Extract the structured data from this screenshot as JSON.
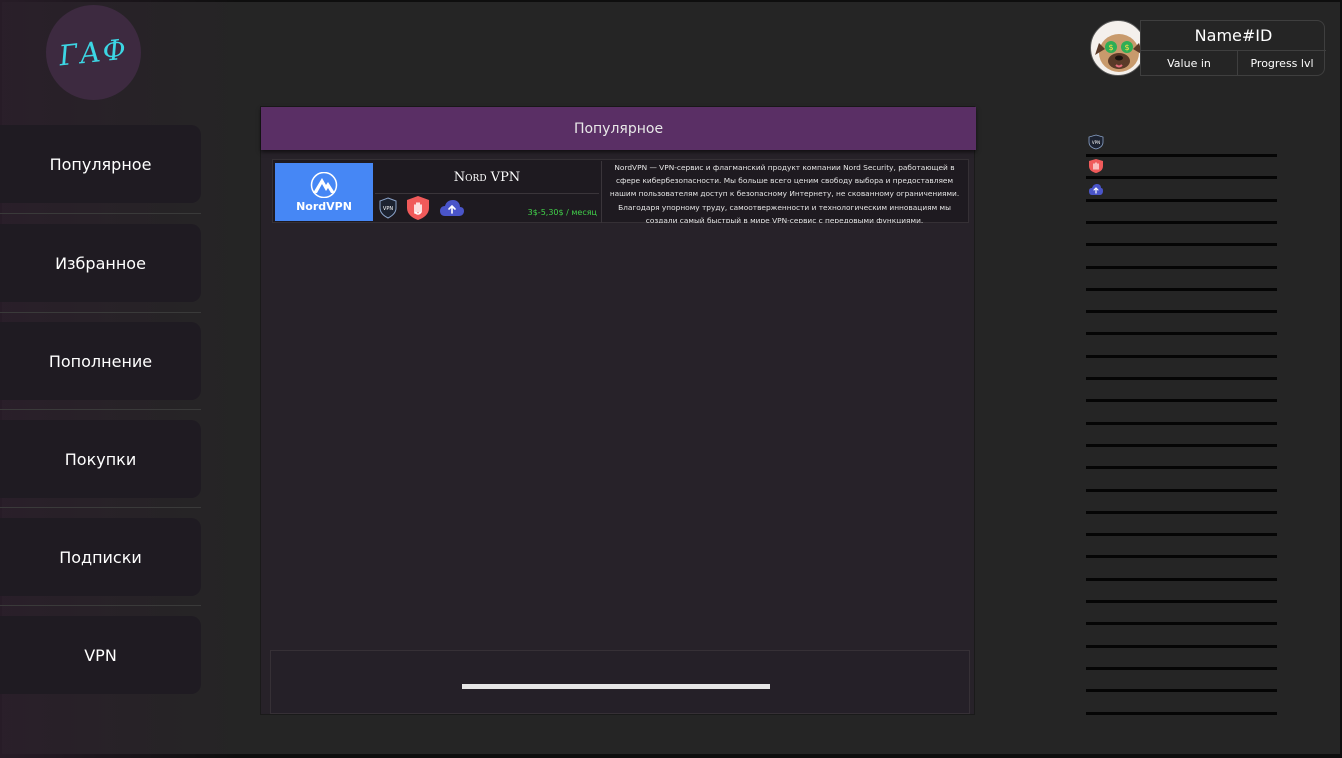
{
  "logo": {
    "text": "ГАФ"
  },
  "nav": {
    "items": [
      {
        "id": "popular",
        "label": "Популярное"
      },
      {
        "id": "favorites",
        "label": "Избранное"
      },
      {
        "id": "topup",
        "label": "Пополнение"
      },
      {
        "id": "purchases",
        "label": "Покупки"
      },
      {
        "id": "subscriptions",
        "label": "Подписки"
      },
      {
        "id": "vpn",
        "label": "VPN"
      }
    ]
  },
  "main": {
    "header": "Популярное",
    "cards": [
      {
        "title": "Nord VPN",
        "image_label": "NordVPN",
        "price": "3$-5,30$ / месяц",
        "icons": [
          "vpn-badge-icon",
          "shield-hand-icon",
          "cloud-upload-icon"
        ],
        "description": "NordVPN — VPN-сервис и флагманский продукт компании Nord Security, работающей в сфере кибербезопасности. Мы больше всего ценим свободу выбора и предоставляем нашим пользователям доступ к безопасному Интернету, не скованному ограничениями. Благодаря упорному труду, самоотверженности и технологическим инновациям мы создали самый быстрый в мире VPN-сервис с передовыми функциями."
      }
    ]
  },
  "profile": {
    "name": "Name#ID",
    "value_label": "Value in",
    "progress_label": "Progress lvl"
  },
  "sidebar_right": {
    "icons": [
      "vpn-badge-icon",
      "shield-hand-icon",
      "cloud-upload-icon"
    ]
  },
  "colors": {
    "background": "#252525",
    "header_purple": "#5a2f65",
    "logo_accent": "#3cd6e4",
    "price_green": "#41d04a",
    "nordvpn_blue": "#4687f5",
    "shield_red": "#f05a5a",
    "cloud_blue": "#4a55c9"
  }
}
